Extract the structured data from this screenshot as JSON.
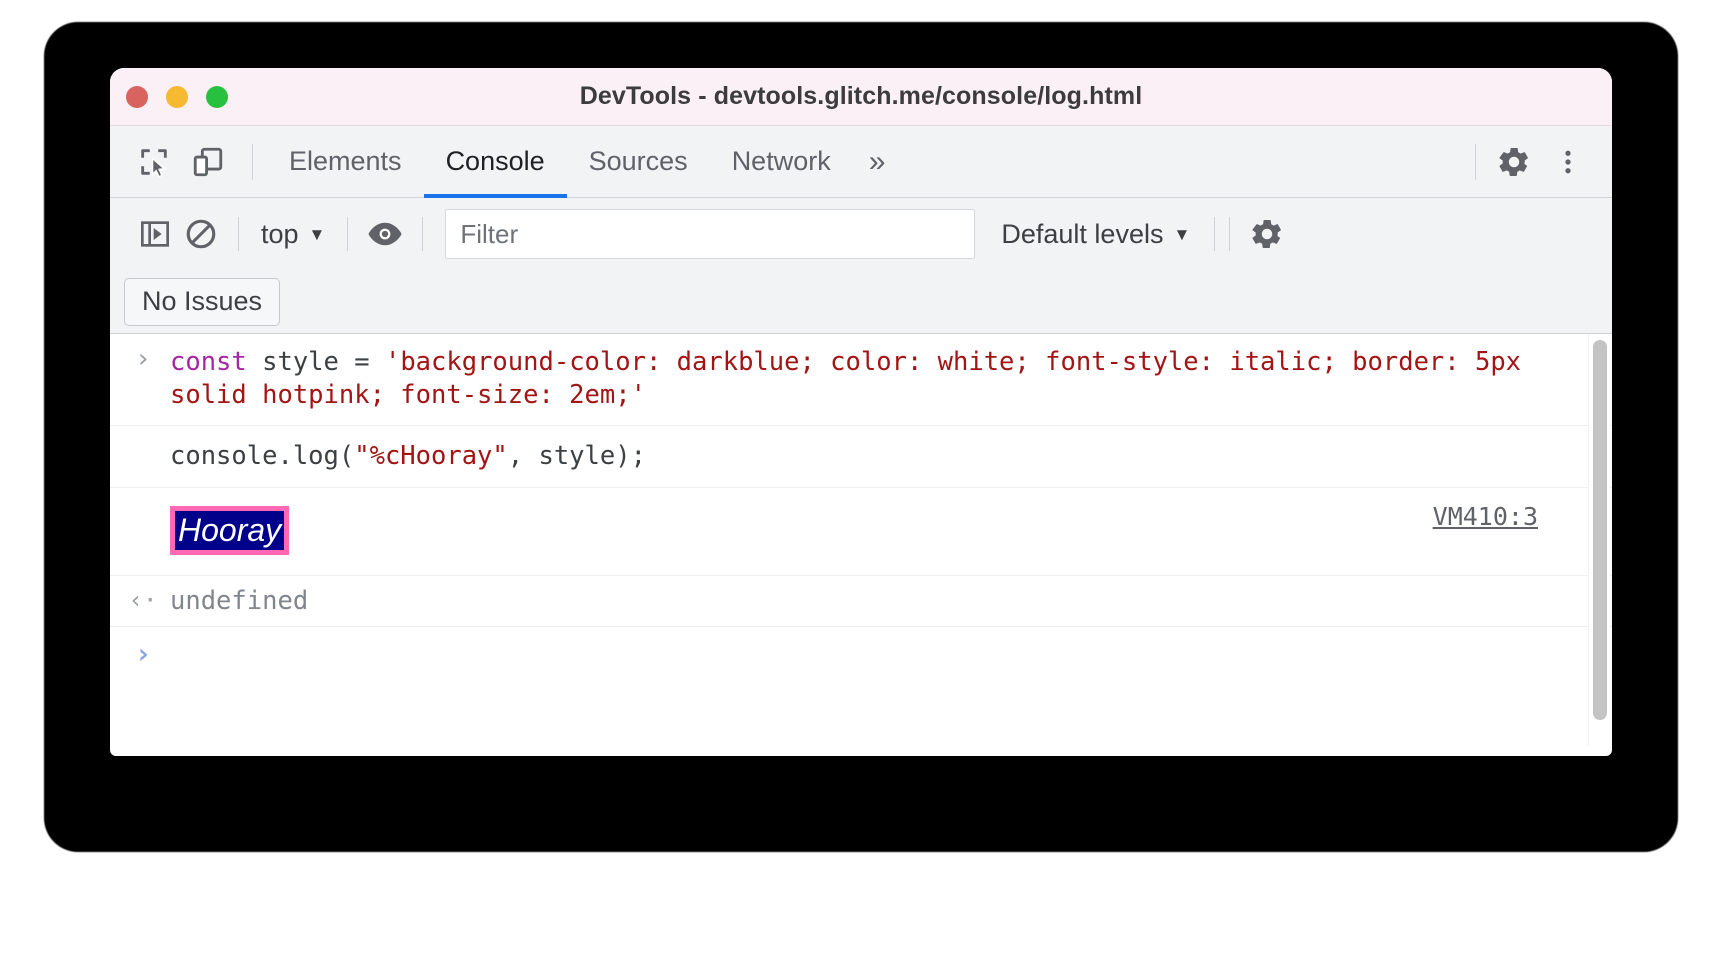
{
  "window": {
    "title": "DevTools - devtools.glitch.me/console/log.html",
    "traffic_lights": [
      {
        "name": "close",
        "color": "#d9635f"
      },
      {
        "name": "minimize",
        "color": "#f5b932"
      },
      {
        "name": "maximize",
        "color": "#28c13f"
      }
    ]
  },
  "toolbar": {
    "inspect_icon": "inspect-element-icon",
    "device_icon": "device-toolbar-icon",
    "tabs": [
      {
        "label": "Elements",
        "active": false
      },
      {
        "label": "Console",
        "active": true
      },
      {
        "label": "Sources",
        "active": false
      },
      {
        "label": "Network",
        "active": false
      }
    ],
    "more_tabs": "»",
    "settings_icon": "gear-icon",
    "menu_icon": "vertical-dots-icon",
    "active_tab_color": "#1a73e8"
  },
  "console_toolbar": {
    "sidebar_toggle_icon": "console-sidebar-icon",
    "clear_icon": "clear-console-icon",
    "context": "top",
    "context_caret": "▼",
    "eye_icon": "live-expression-eye-icon",
    "filter_placeholder": "Filter",
    "filter_value": "",
    "levels_label": "Default levels",
    "levels_caret": "▼",
    "settings_icon": "console-settings-gear-icon"
  },
  "issues": {
    "label": "No Issues"
  },
  "console": {
    "rows": [
      {
        "type": "input",
        "gutter": "›",
        "segments": [
          {
            "text": "const ",
            "cls": "kw"
          },
          {
            "text": "style ",
            "cls": "pln"
          },
          {
            "text": "= ",
            "cls": "pln"
          },
          {
            "text": "'background-color: darkblue; color: white; font-style: italic; border: 5px solid hotpink; font-size: 2em;'",
            "cls": "str"
          }
        ]
      },
      {
        "type": "input",
        "gutter": "",
        "segments": [
          {
            "text": "console.log(",
            "cls": "pln"
          },
          {
            "text": "\"%cHooray\"",
            "cls": "str"
          },
          {
            "text": ", style);",
            "cls": "pln"
          }
        ]
      },
      {
        "type": "styled-output",
        "gutter": "",
        "text": "Hooray",
        "source": "VM410:3",
        "style": {
          "background_color": "#00008B",
          "color": "#ffffff",
          "font_style": "italic",
          "border": "5px solid #ff69b4",
          "font_size": "2em"
        }
      },
      {
        "type": "result",
        "gutter": "‹·",
        "text": "undefined"
      },
      {
        "type": "prompt",
        "gutter": "›",
        "text": ""
      }
    ]
  },
  "colors": {
    "titlebar_bg": "#faf0f5",
    "toolbar_bg": "#f1f3f4",
    "accent": "#1a73e8",
    "hotpink": "#ff69b4",
    "darkblue": "#00008B",
    "string_red": "#a31515",
    "keyword_purple": "#a626a4",
    "prompt_blue": "#8ba4e3"
  }
}
